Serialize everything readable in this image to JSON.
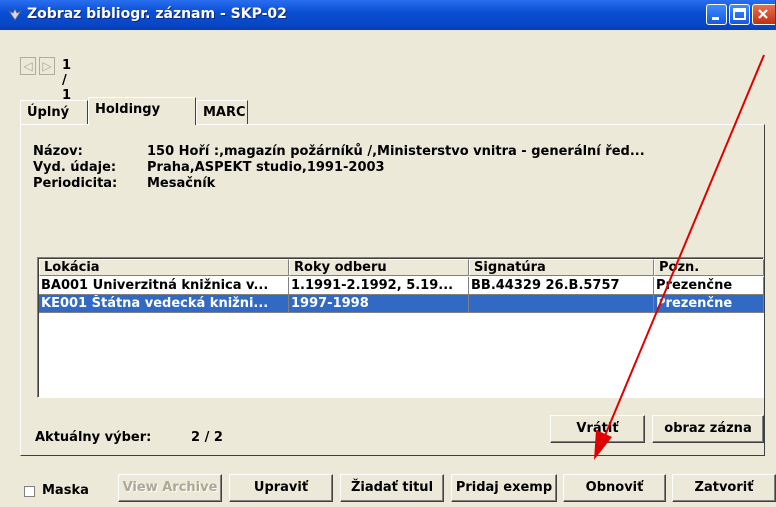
{
  "window": {
    "title": "Zobraz bibliogr. záznam - SKP-02"
  },
  "nav": {
    "prev_icon": "◁",
    "next_icon": "▷",
    "record_count": "1 / 1"
  },
  "tabs": [
    {
      "label": "Úplný"
    },
    {
      "label": "Holdingy"
    },
    {
      "label": "MARC"
    }
  ],
  "active_tab": "Holdingy",
  "record": {
    "title_label": "Názov:",
    "title_value": "150 Hoří :,magazín požárníků /,Ministerstvo vnitra - generální řed...",
    "publisher_label": "Vyd. údaje:",
    "publisher_value": "Praha,ASPEKT studio,1991-2003",
    "periodicity_label": "Periodicita:",
    "periodicity_value": "Mesačník"
  },
  "holdings_table": {
    "columns": [
      "Lokácia",
      "Roky odberu",
      "Signatúra",
      "Pozn."
    ],
    "rows": [
      [
        "BA001 Univerzitná knižnica v...",
        "1.1991-2.1992, 5.19...",
        "BB.44329 26.B.5757",
        "Prezenčne"
      ],
      [
        "KE001 Štátna vedecká knižni...",
        "1997-1998",
        "",
        "Prezenčne"
      ]
    ],
    "selected_row": 1
  },
  "panel_buttons": {
    "back_label": "Vrátiť",
    "show_record_label": "obraz zázna"
  },
  "status": {
    "label": "Aktuálny výber:",
    "value": "2 / 2"
  },
  "bottom": {
    "mask_label": "Maska",
    "view_archive_label": "View Archive",
    "edit_label": "Upraviť",
    "request_title_label": "Žiadať titul",
    "add_copy_label": "Pridaj exemp",
    "refresh_label": "Obnoviť",
    "close_label": "Zatvoriť"
  },
  "colors": {
    "titlebar": "#0a4fd4",
    "selection": "#316ac5",
    "annotation_arrow": "#e00000"
  }
}
